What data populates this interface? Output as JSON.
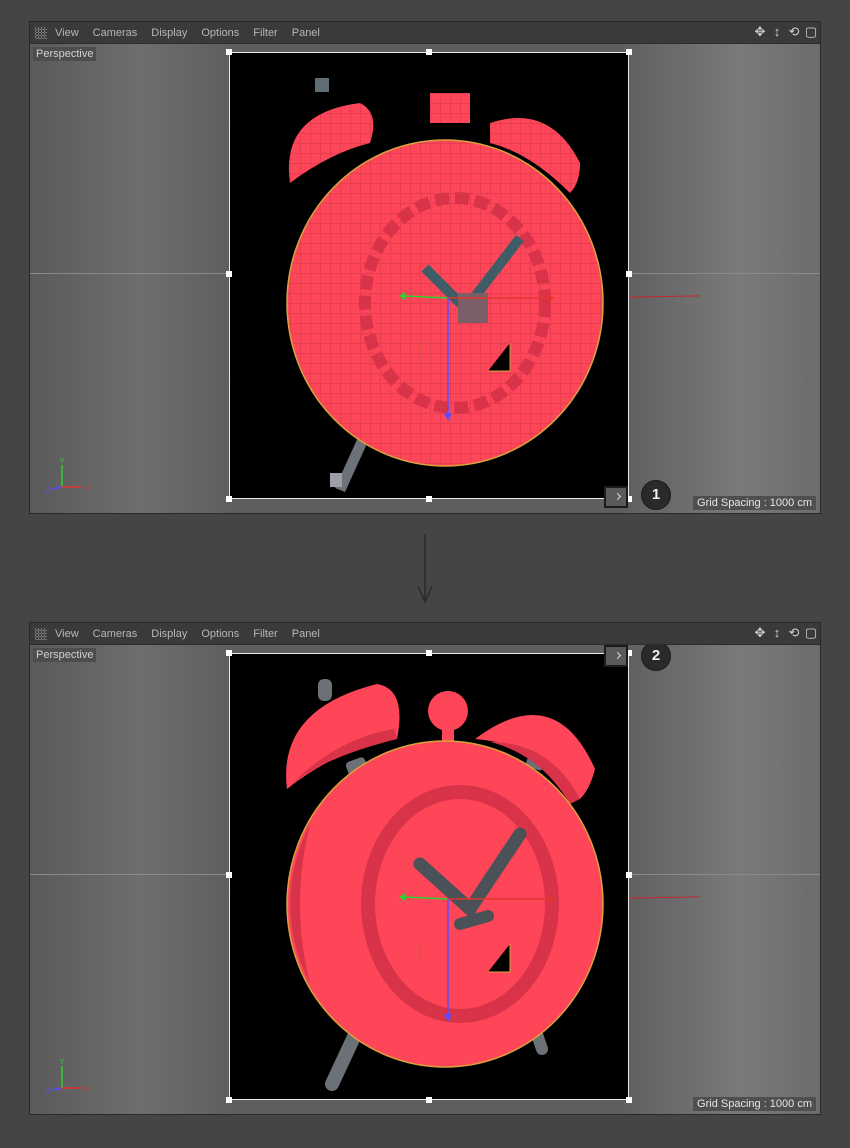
{
  "menu": {
    "items": [
      "View",
      "Cameras",
      "Display",
      "Options",
      "Filter",
      "Panel"
    ]
  },
  "nav_icons": [
    "move-icon",
    "zoom-icon",
    "rotate-icon",
    "maximize-icon"
  ],
  "viewports": [
    {
      "camera_label": "Perspective",
      "grid_spacing": "Grid Spacing : 1000 cm",
      "step": "1",
      "image_style": "pixelated"
    },
    {
      "camera_label": "Perspective",
      "grid_spacing": "Grid Spacing : 1000 cm",
      "step": "2",
      "image_style": "smooth"
    }
  ],
  "colors": {
    "clock_red": "#ff4558",
    "clock_shade": "#d9334a",
    "hands": "#4a5157",
    "gizmo_x": "#e2352f",
    "gizmo_y": "#2fd12f",
    "gizmo_z": "#5a4bff",
    "selection": "#d8a43a"
  },
  "axis_labels": {
    "x": "X",
    "y": "Y",
    "z": "Z"
  }
}
